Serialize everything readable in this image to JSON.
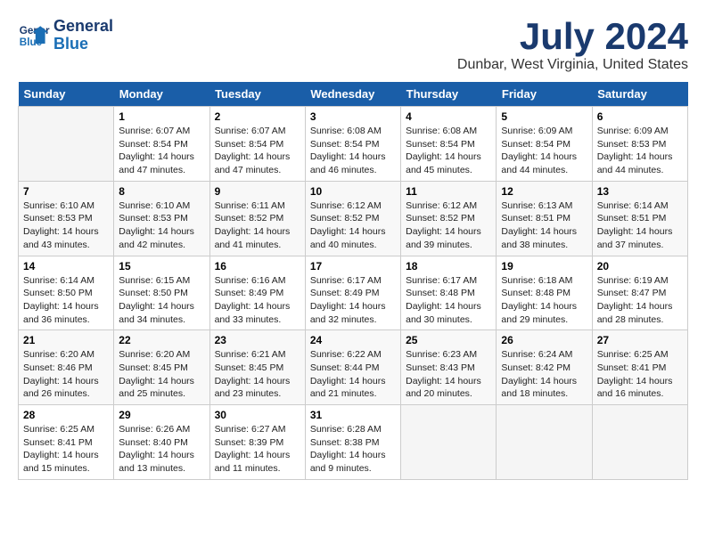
{
  "header": {
    "logo_line1": "General",
    "logo_line2": "Blue",
    "title": "July 2024",
    "subtitle": "Dunbar, West Virginia, United States"
  },
  "calendar": {
    "days_of_week": [
      "Sunday",
      "Monday",
      "Tuesday",
      "Wednesday",
      "Thursday",
      "Friday",
      "Saturday"
    ],
    "weeks": [
      [
        {
          "num": "",
          "empty": true
        },
        {
          "num": "1",
          "sunrise": "Sunrise: 6:07 AM",
          "sunset": "Sunset: 8:54 PM",
          "daylight": "Daylight: 14 hours and 47 minutes."
        },
        {
          "num": "2",
          "sunrise": "Sunrise: 6:07 AM",
          "sunset": "Sunset: 8:54 PM",
          "daylight": "Daylight: 14 hours and 47 minutes."
        },
        {
          "num": "3",
          "sunrise": "Sunrise: 6:08 AM",
          "sunset": "Sunset: 8:54 PM",
          "daylight": "Daylight: 14 hours and 46 minutes."
        },
        {
          "num": "4",
          "sunrise": "Sunrise: 6:08 AM",
          "sunset": "Sunset: 8:54 PM",
          "daylight": "Daylight: 14 hours and 45 minutes."
        },
        {
          "num": "5",
          "sunrise": "Sunrise: 6:09 AM",
          "sunset": "Sunset: 8:54 PM",
          "daylight": "Daylight: 14 hours and 44 minutes."
        },
        {
          "num": "6",
          "sunrise": "Sunrise: 6:09 AM",
          "sunset": "Sunset: 8:53 PM",
          "daylight": "Daylight: 14 hours and 44 minutes."
        }
      ],
      [
        {
          "num": "7",
          "sunrise": "Sunrise: 6:10 AM",
          "sunset": "Sunset: 8:53 PM",
          "daylight": "Daylight: 14 hours and 43 minutes."
        },
        {
          "num": "8",
          "sunrise": "Sunrise: 6:10 AM",
          "sunset": "Sunset: 8:53 PM",
          "daylight": "Daylight: 14 hours and 42 minutes."
        },
        {
          "num": "9",
          "sunrise": "Sunrise: 6:11 AM",
          "sunset": "Sunset: 8:52 PM",
          "daylight": "Daylight: 14 hours and 41 minutes."
        },
        {
          "num": "10",
          "sunrise": "Sunrise: 6:12 AM",
          "sunset": "Sunset: 8:52 PM",
          "daylight": "Daylight: 14 hours and 40 minutes."
        },
        {
          "num": "11",
          "sunrise": "Sunrise: 6:12 AM",
          "sunset": "Sunset: 8:52 PM",
          "daylight": "Daylight: 14 hours and 39 minutes."
        },
        {
          "num": "12",
          "sunrise": "Sunrise: 6:13 AM",
          "sunset": "Sunset: 8:51 PM",
          "daylight": "Daylight: 14 hours and 38 minutes."
        },
        {
          "num": "13",
          "sunrise": "Sunrise: 6:14 AM",
          "sunset": "Sunset: 8:51 PM",
          "daylight": "Daylight: 14 hours and 37 minutes."
        }
      ],
      [
        {
          "num": "14",
          "sunrise": "Sunrise: 6:14 AM",
          "sunset": "Sunset: 8:50 PM",
          "daylight": "Daylight: 14 hours and 36 minutes."
        },
        {
          "num": "15",
          "sunrise": "Sunrise: 6:15 AM",
          "sunset": "Sunset: 8:50 PM",
          "daylight": "Daylight: 14 hours and 34 minutes."
        },
        {
          "num": "16",
          "sunrise": "Sunrise: 6:16 AM",
          "sunset": "Sunset: 8:49 PM",
          "daylight": "Daylight: 14 hours and 33 minutes."
        },
        {
          "num": "17",
          "sunrise": "Sunrise: 6:17 AM",
          "sunset": "Sunset: 8:49 PM",
          "daylight": "Daylight: 14 hours and 32 minutes."
        },
        {
          "num": "18",
          "sunrise": "Sunrise: 6:17 AM",
          "sunset": "Sunset: 8:48 PM",
          "daylight": "Daylight: 14 hours and 30 minutes."
        },
        {
          "num": "19",
          "sunrise": "Sunrise: 6:18 AM",
          "sunset": "Sunset: 8:48 PM",
          "daylight": "Daylight: 14 hours and 29 minutes."
        },
        {
          "num": "20",
          "sunrise": "Sunrise: 6:19 AM",
          "sunset": "Sunset: 8:47 PM",
          "daylight": "Daylight: 14 hours and 28 minutes."
        }
      ],
      [
        {
          "num": "21",
          "sunrise": "Sunrise: 6:20 AM",
          "sunset": "Sunset: 8:46 PM",
          "daylight": "Daylight: 14 hours and 26 minutes."
        },
        {
          "num": "22",
          "sunrise": "Sunrise: 6:20 AM",
          "sunset": "Sunset: 8:45 PM",
          "daylight": "Daylight: 14 hours and 25 minutes."
        },
        {
          "num": "23",
          "sunrise": "Sunrise: 6:21 AM",
          "sunset": "Sunset: 8:45 PM",
          "daylight": "Daylight: 14 hours and 23 minutes."
        },
        {
          "num": "24",
          "sunrise": "Sunrise: 6:22 AM",
          "sunset": "Sunset: 8:44 PM",
          "daylight": "Daylight: 14 hours and 21 minutes."
        },
        {
          "num": "25",
          "sunrise": "Sunrise: 6:23 AM",
          "sunset": "Sunset: 8:43 PM",
          "daylight": "Daylight: 14 hours and 20 minutes."
        },
        {
          "num": "26",
          "sunrise": "Sunrise: 6:24 AM",
          "sunset": "Sunset: 8:42 PM",
          "daylight": "Daylight: 14 hours and 18 minutes."
        },
        {
          "num": "27",
          "sunrise": "Sunrise: 6:25 AM",
          "sunset": "Sunset: 8:41 PM",
          "daylight": "Daylight: 14 hours and 16 minutes."
        }
      ],
      [
        {
          "num": "28",
          "sunrise": "Sunrise: 6:25 AM",
          "sunset": "Sunset: 8:41 PM",
          "daylight": "Daylight: 14 hours and 15 minutes."
        },
        {
          "num": "29",
          "sunrise": "Sunrise: 6:26 AM",
          "sunset": "Sunset: 8:40 PM",
          "daylight": "Daylight: 14 hours and 13 minutes."
        },
        {
          "num": "30",
          "sunrise": "Sunrise: 6:27 AM",
          "sunset": "Sunset: 8:39 PM",
          "daylight": "Daylight: 14 hours and 11 minutes."
        },
        {
          "num": "31",
          "sunrise": "Sunrise: 6:28 AM",
          "sunset": "Sunset: 8:38 PM",
          "daylight": "Daylight: 14 hours and 9 minutes."
        },
        {
          "num": "",
          "empty": true
        },
        {
          "num": "",
          "empty": true
        },
        {
          "num": "",
          "empty": true
        }
      ]
    ]
  }
}
